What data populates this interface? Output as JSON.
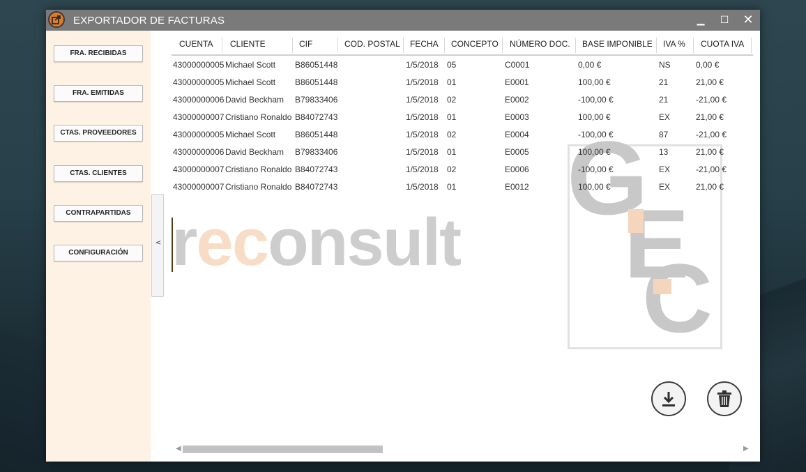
{
  "window": {
    "title": "EXPORTADOR DE FACTURAS",
    "minimize_glyph": "▁",
    "maximize_glyph": "☐",
    "close_glyph": "✕"
  },
  "sidebar": {
    "items": [
      {
        "label": "FRA. RECIBIDAS"
      },
      {
        "label": "FRA. EMITIDAS"
      },
      {
        "label": "CTAS. PROVEEDORES"
      },
      {
        "label": "CTAS. CLIENTES"
      },
      {
        "label": "CONTRAPARTIDAS"
      },
      {
        "label": "CONFIGURACIÓN"
      }
    ],
    "collapse_glyph": "<"
  },
  "table": {
    "headers": [
      "CUENTA",
      "CLIENTE",
      "CIF",
      "COD. POSTAL",
      "FECHA",
      "CONCEPTO",
      "NÚMERO DOC.",
      "BASE IMPONIBLE",
      "IVA %",
      "CUOTA IVA"
    ],
    "rows": [
      [
        "43000000005",
        "Michael Scott",
        "B86051448",
        "",
        "1/5/2018",
        "05",
        "C0001",
        "0,00 €",
        "NS",
        "0,00 €"
      ],
      [
        "43000000005",
        "Michael Scott",
        "B86051448",
        "",
        "1/5/2018",
        "01",
        "E0001",
        "100,00 €",
        "21",
        "21,00 €"
      ],
      [
        "43000000006",
        "David Beckham",
        "B79833406",
        "",
        "1/5/2018",
        "02",
        "E0002",
        "-100,00 €",
        "21",
        "-21,00 €"
      ],
      [
        "43000000007",
        "Cristiano Ronaldo",
        "B84072743",
        "",
        "1/5/2018",
        "01",
        "E0003",
        "100,00 €",
        "EX",
        "21,00 €"
      ],
      [
        "43000000005",
        "Michael Scott",
        "B86051448",
        "",
        "1/5/2018",
        "02",
        "E0004",
        "-100,00 €",
        "87",
        "-21,00 €"
      ],
      [
        "43000000006",
        "David Beckham",
        "B79833406",
        "",
        "1/5/2018",
        "01",
        "E0005",
        "100,00 €",
        "13",
        "21,00 €"
      ],
      [
        "43000000007",
        "Cristiano Ronaldo",
        "B84072743",
        "",
        "1/5/2018",
        "02",
        "E0006",
        "-100,00 €",
        "EX",
        "-21,00 €"
      ],
      [
        "43000000007",
        "Cristiano Ronaldo",
        "B84072743",
        "",
        "1/5/2018",
        "01",
        "E0012",
        "100,00 €",
        "EX",
        "21,00 €"
      ]
    ]
  },
  "watermark": {
    "text_gray_start": "r",
    "text_orange": "ec",
    "text_gray_end": "onsult",
    "logo_letters": [
      "G",
      "E",
      "C"
    ]
  },
  "actions": {
    "download_icon": "download-icon",
    "delete_icon": "trash-icon"
  },
  "scrollbar": {
    "left_glyph": "◀",
    "right_glyph": "▶"
  }
}
